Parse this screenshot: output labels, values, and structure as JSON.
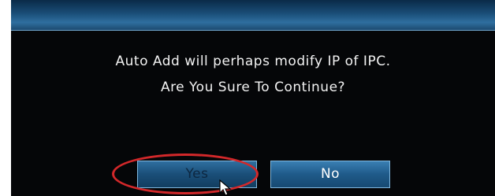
{
  "dialog": {
    "message_line1": "Auto Add will perhaps modify IP of IPC.",
    "message_line2": "Are You Sure To Continue?",
    "yes_label": "Yes",
    "no_label": "No"
  },
  "colors": {
    "titlebar": "#1a4e78",
    "button": "#1f5a89",
    "highlight": "#d3282a",
    "background": "#050608"
  },
  "icons": {
    "cursor": "mouse-pointer-icon"
  }
}
